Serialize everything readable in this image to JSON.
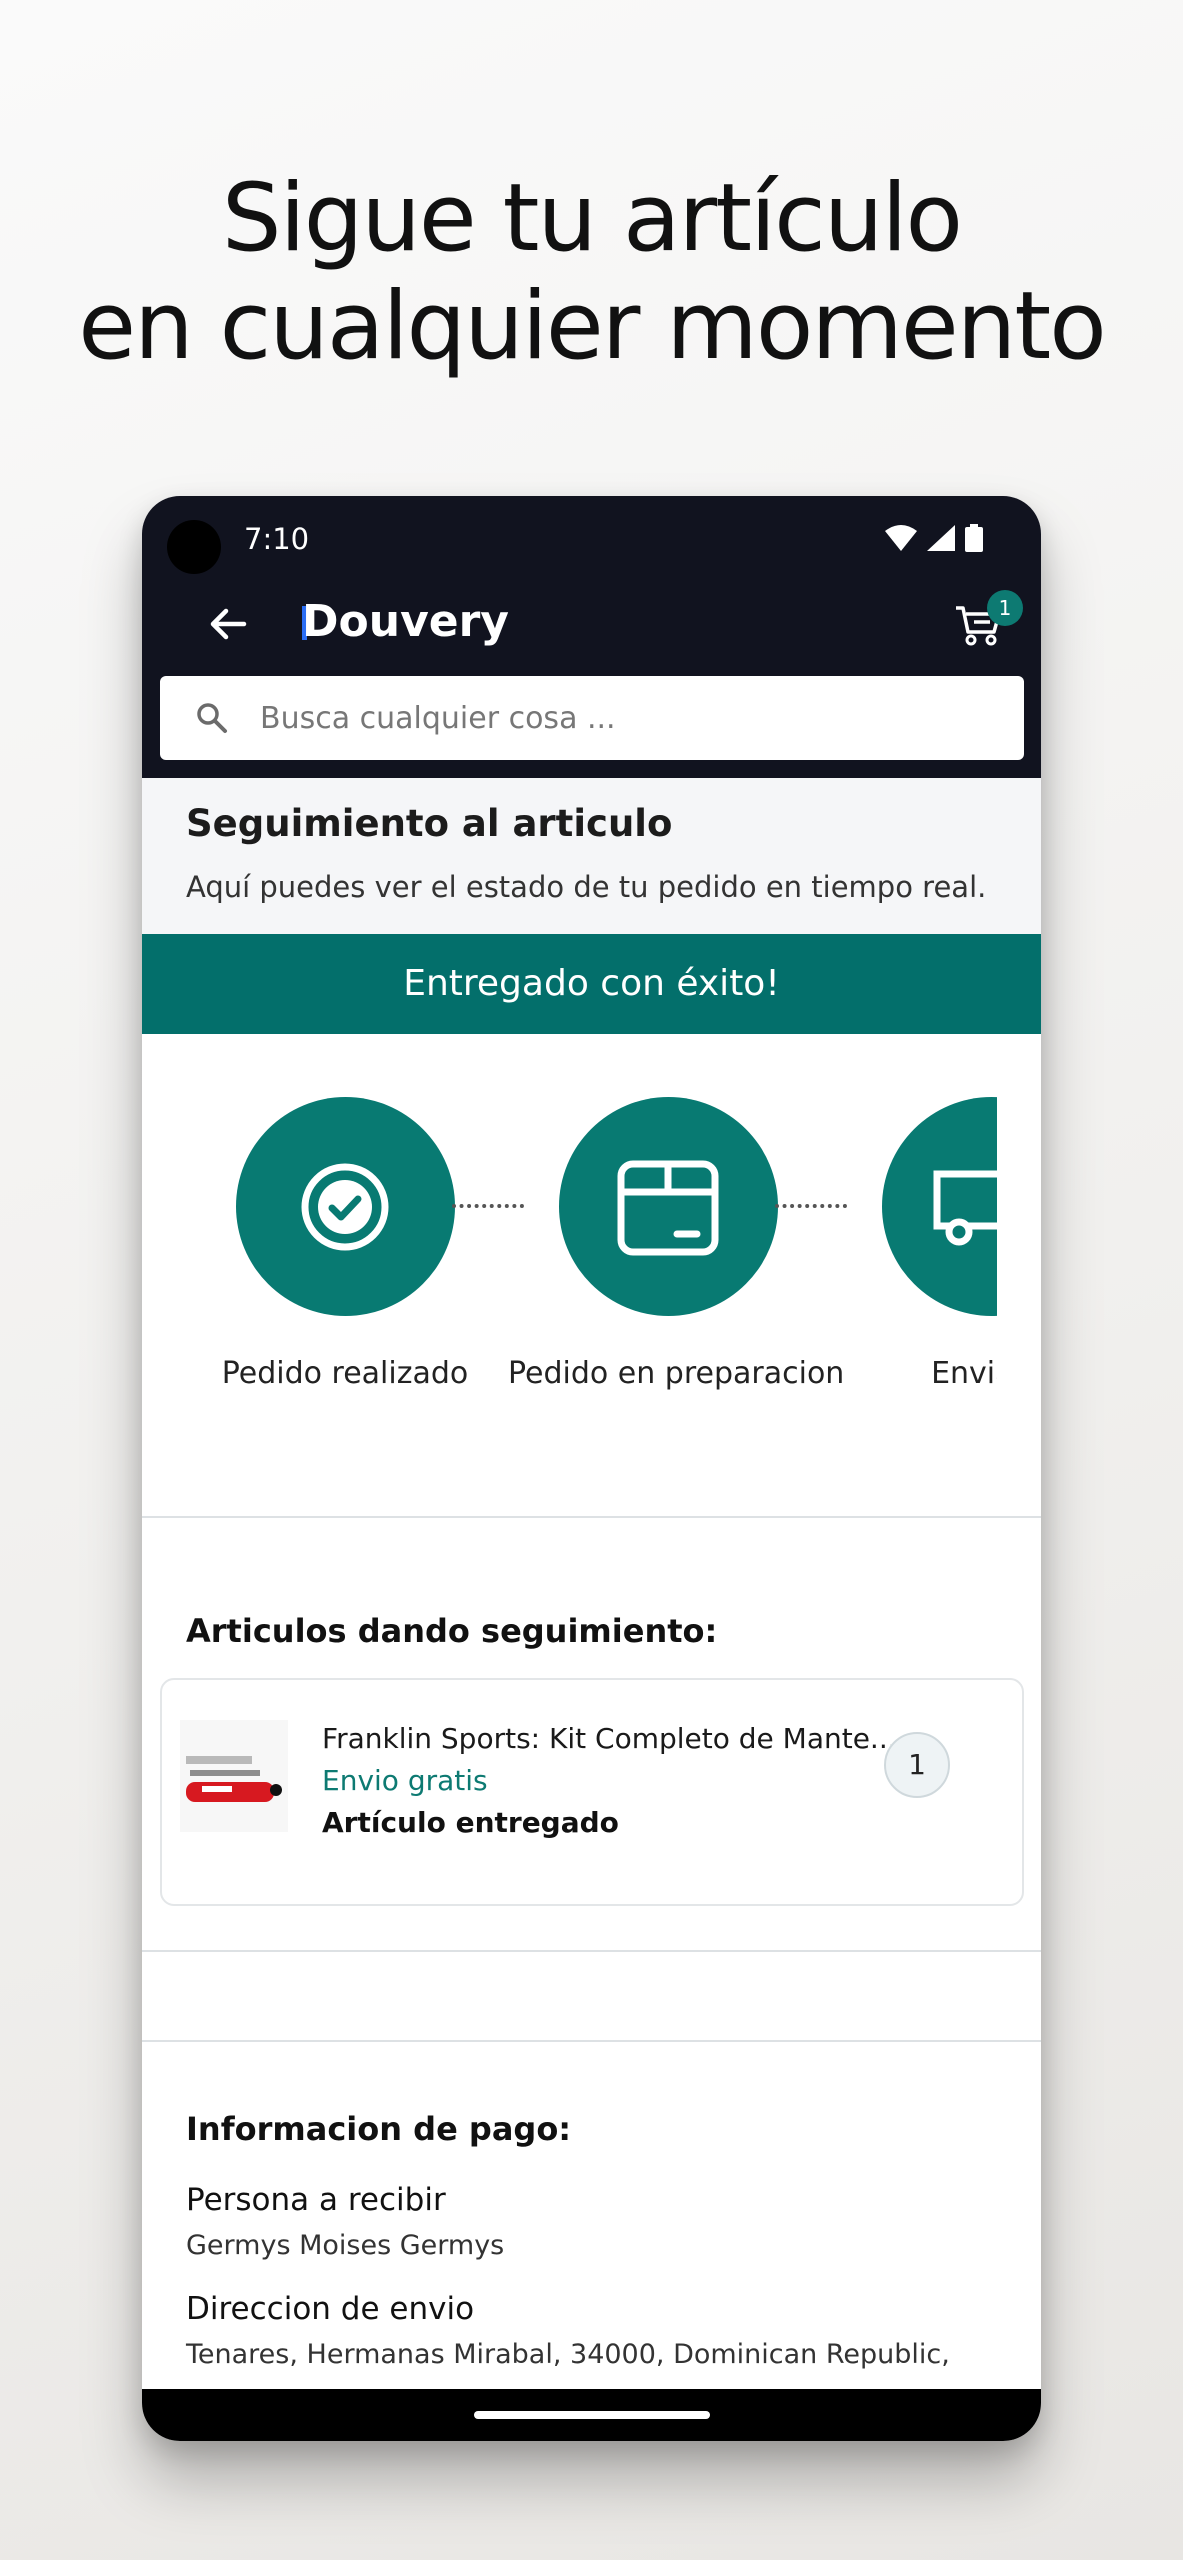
{
  "headline": {
    "line1": "Sigue tu artículo",
    "line2": "en cualquier momento"
  },
  "status_bar": {
    "time": "7:10"
  },
  "app_bar": {
    "logo": "Douvery",
    "cart_count": "1"
  },
  "search": {
    "placeholder": "Busca cualquier cosa ..."
  },
  "tracking": {
    "title": "Seguimiento al articulo",
    "subtitle": "Aquí puedes ver el estado de tu pedido en tiempo real.",
    "banner": "Entregado con éxito!",
    "steps": [
      {
        "label": "Pedido realizado",
        "icon": "check-circle-icon"
      },
      {
        "label": "Pedido en preparacion",
        "icon": "package-icon"
      },
      {
        "label": "Enviado",
        "icon": "truck-icon"
      }
    ]
  },
  "items_section": {
    "title": "Articulos dando seguimiento:",
    "items": [
      {
        "name": "Franklin Sports: Kit Completo de Mante...",
        "shipping": "Envio gratis",
        "status": "Artículo entregado",
        "quantity": "1"
      }
    ]
  },
  "payment": {
    "title": "Informacion de pago:",
    "recipient_label": "Persona a recibir",
    "recipient_value": "Germys Moises Germys",
    "address_label": "Direccion de envio",
    "address_value": "Tenares, Hermanas Mirabal, 34000, Dominican Republic,"
  },
  "colors": {
    "primary": "#087a72",
    "dark": "#11131f",
    "banner": "#036f6b"
  }
}
